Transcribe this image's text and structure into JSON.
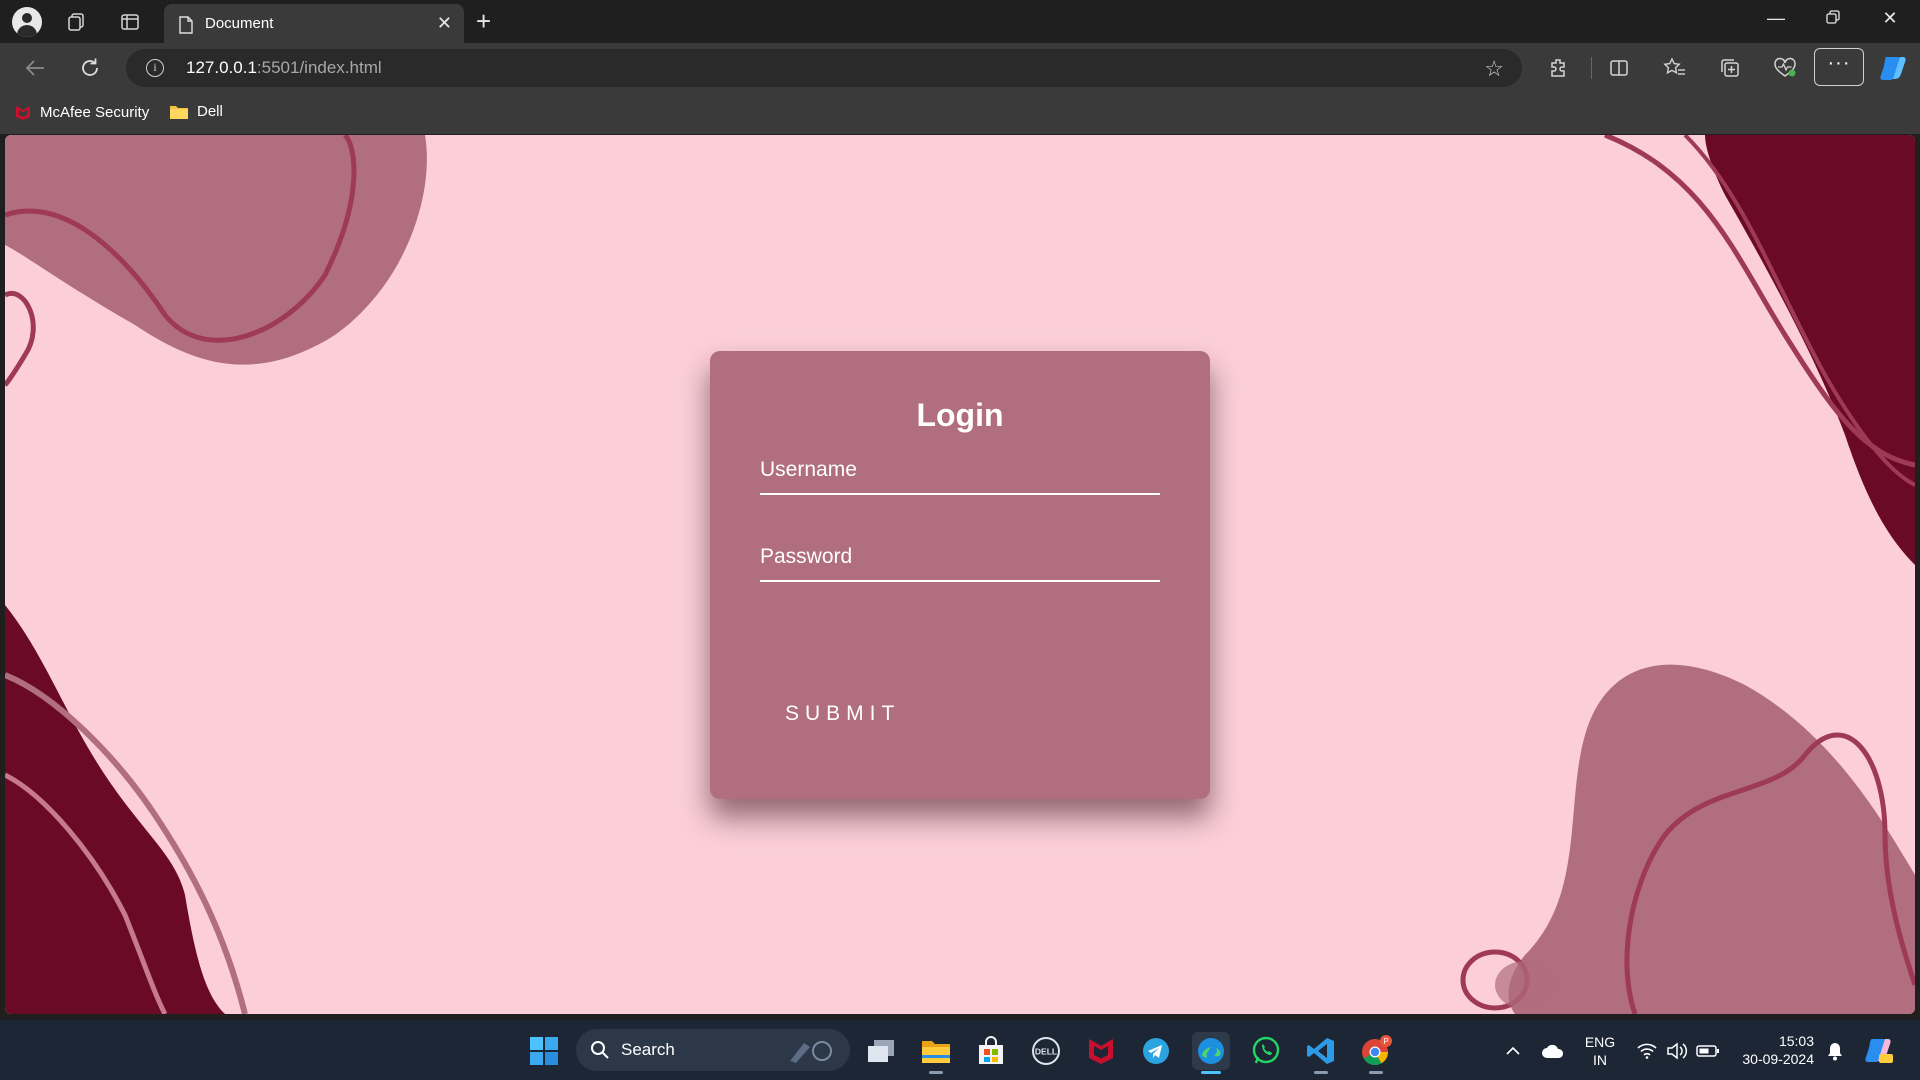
{
  "browser": {
    "tab_title": "Document",
    "url_host": "127.0.0.1",
    "url_rest": ":5501/index.html"
  },
  "bookmarks": [
    {
      "label": "McAfee Security",
      "icon": "mcafee-icon"
    },
    {
      "label": "Dell",
      "icon": "folder-icon"
    }
  ],
  "login": {
    "title": "Login",
    "username_placeholder": "Username",
    "password_placeholder": "Password",
    "submit_label": "SUBMIT"
  },
  "colors": {
    "page_background": "#fbced8",
    "card_background": "#b06e7e",
    "blob_muted": "#b06e7e",
    "blob_dark": "#6a0a26",
    "curve_stroke": "#9e3a55"
  },
  "taskbar": {
    "search_label": "Search",
    "apps": [
      "windows-start-icon",
      "task-view-icon",
      "file-explorer-icon",
      "microsoft-store-icon",
      "dell-icon",
      "mcafee-icon",
      "telegram-icon",
      "edge-icon",
      "whatsapp-icon",
      "vscode-icon",
      "chrome-icon"
    ],
    "language_line1": "ENG",
    "language_line2": "IN",
    "time": "15:03",
    "date": "30-09-2024"
  }
}
